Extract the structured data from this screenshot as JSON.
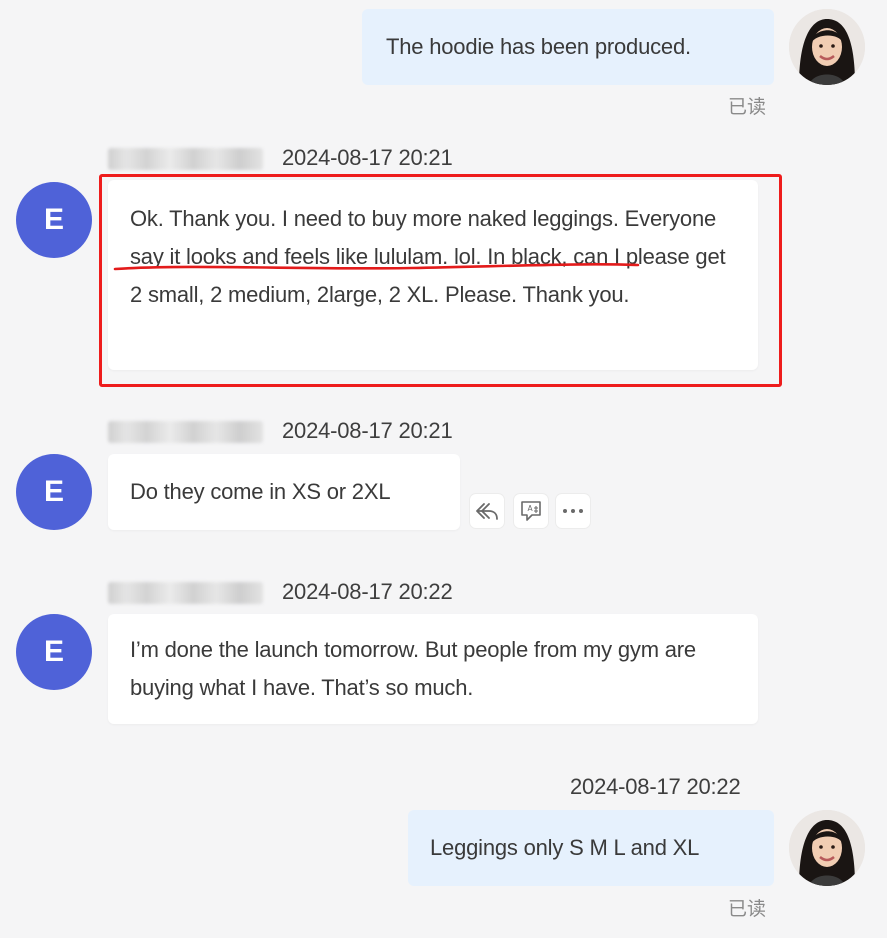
{
  "messages": [
    {
      "direction": "outgoing",
      "text": "The hoodie has been produced.",
      "status": "已读"
    },
    {
      "direction": "incoming",
      "avatar_letter": "E",
      "timestamp": "2024-08-17 20:21",
      "text": "Ok. Thank you. I need to buy more naked leggings. Everyone say it looks and feels like lululam. lol. In black, can I please get 2 small, 2 medium, 2large, 2 XL. Please. Thank you.",
      "highlighted": true
    },
    {
      "direction": "incoming",
      "avatar_letter": "E",
      "timestamp": "2024-08-17 20:21",
      "text": "Do they come in XS or 2XL",
      "actions": [
        "reply-icon",
        "translate-icon",
        "more-icon"
      ]
    },
    {
      "direction": "incoming",
      "avatar_letter": "E",
      "timestamp": "2024-08-17 20:22",
      "text": "I’m done the launch tomorrow. But people from my gym are buying what I have. That’s so much."
    },
    {
      "direction": "outgoing",
      "timestamp": "2024-08-17 20:22",
      "text": "Leggings only S M L and XL",
      "status": "已读"
    }
  ],
  "colors": {
    "background": "#f5f5f6",
    "incoming_bubble": "#ffffff",
    "outgoing_bubble": "#e6f1fd",
    "avatar": "#4f62d8",
    "highlight": "#ee1c1c"
  }
}
